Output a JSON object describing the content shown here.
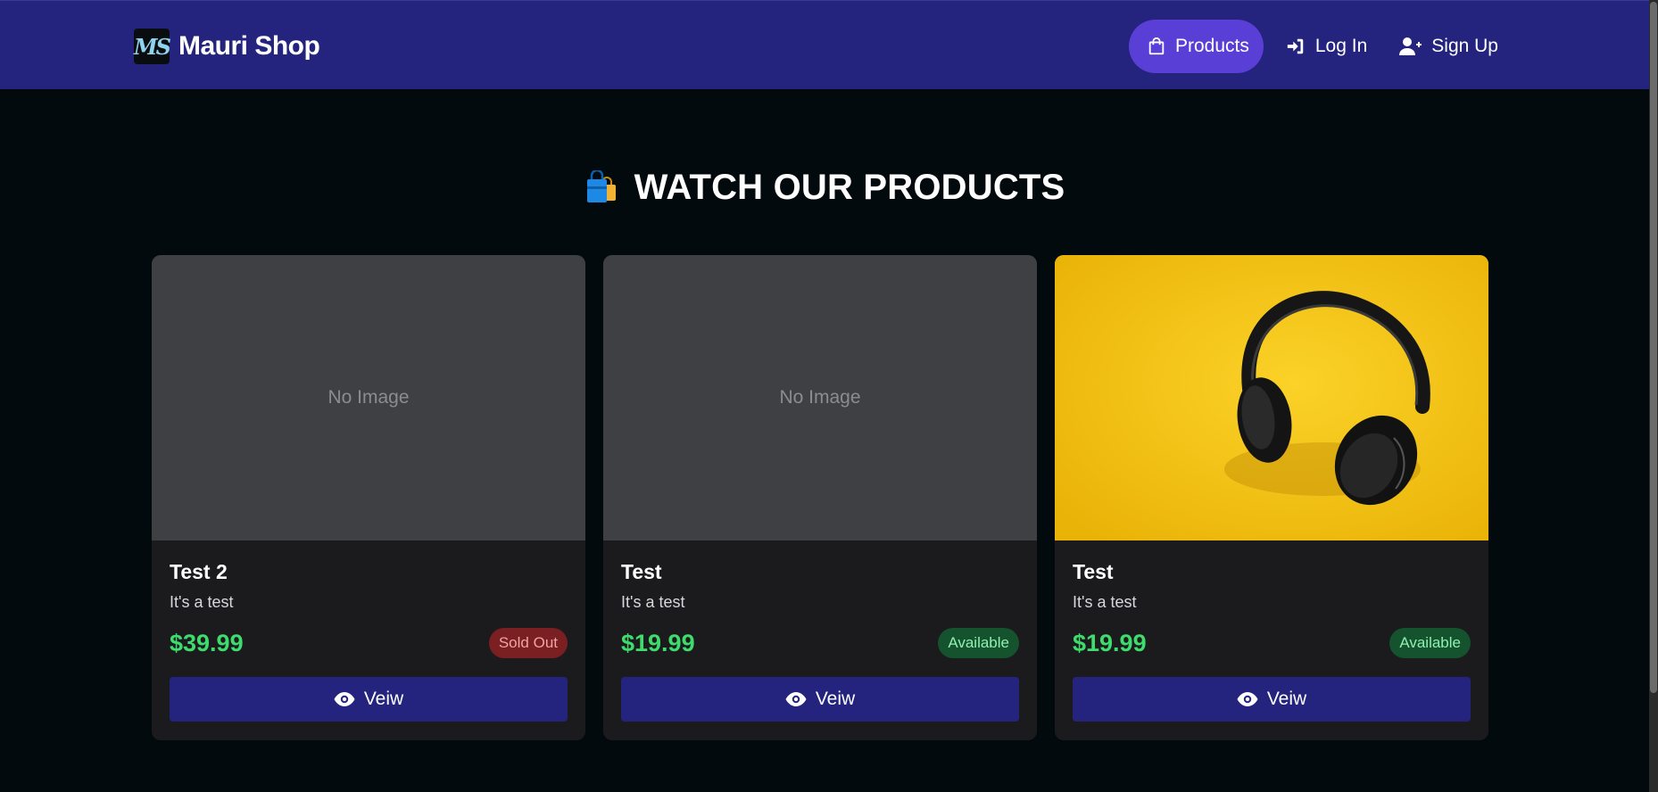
{
  "brand": {
    "logo_text": "MS",
    "name": "Mauri Shop"
  },
  "nav": {
    "products": "Products",
    "login": "Log In",
    "signup": "Sign Up"
  },
  "section": {
    "title": "WATCH OUR PRODUCTS",
    "icon": "shopping-bags-icon"
  },
  "products": [
    {
      "title": "Test 2",
      "description": "It's a test",
      "price": "$39.99",
      "status": "Sold Out",
      "image_text": "No Image",
      "button": "Veiw"
    },
    {
      "title": "Test",
      "description": "It's a test",
      "price": "$19.99",
      "status": "Available",
      "image_text": "No Image",
      "button": "Veiw"
    },
    {
      "title": "Test",
      "description": "It's a test",
      "price": "$19.99",
      "status": "Available",
      "image": "headphones-on-yellow-photo",
      "button": "Veiw"
    }
  ],
  "colors": {
    "navbar": "#24247f",
    "active_nav": "#5a3fd6",
    "price": "#3ddc6c",
    "sold_out_badge": "#7a1f22",
    "available_badge": "#14532d"
  }
}
